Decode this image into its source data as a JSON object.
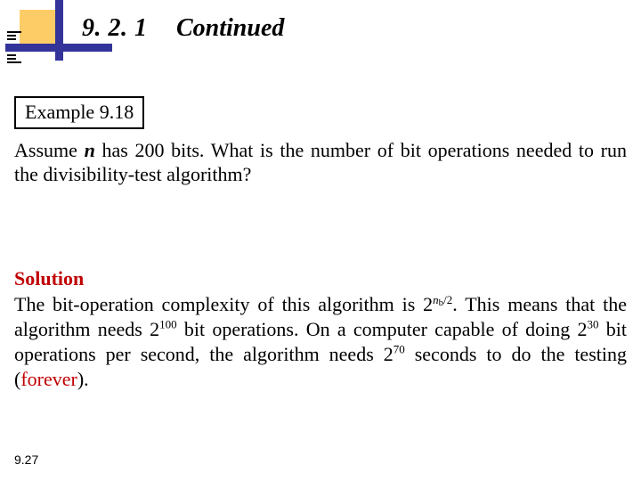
{
  "header": {
    "section_number": "9. 2. 1",
    "section_title": "Continued"
  },
  "example": {
    "label": "Example 9.18",
    "problem_pre": "Assume ",
    "problem_var": "n",
    "problem_post": " has 200 bits. What is the number of bit operations needed to run the divisibility-test algorithm?"
  },
  "solution": {
    "label": "Solution",
    "p1": "The bit-operation complexity of this algorithm is 2",
    "exp1_sub": "n",
    "exp1_b": "b",
    "exp1_tail": "/2",
    "p2": ". This means that the algorithm needs 2",
    "exp2": "100",
    "p3": " bit operations. On a computer capable of doing 2",
    "exp3": "30",
    "p4": " bit operations per second, the algorithm needs 2",
    "exp4": "70",
    "p5": " seconds to do the testing (",
    "forever": "forever",
    "p6": ")."
  },
  "footer": {
    "page": "9.27"
  }
}
